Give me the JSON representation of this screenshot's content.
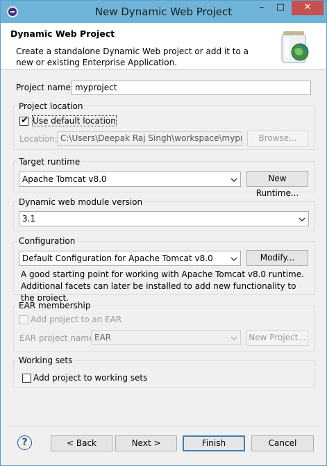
{
  "window": {
    "title": "New Dynamic Web Project",
    "minimize": "–",
    "maximize": "□",
    "close": "✕"
  },
  "banner": {
    "title": "Dynamic Web Project",
    "description": "Create a standalone Dynamic Web project or add it to a new or existing Enterprise Application.",
    "icon": "web-project-wizard-icon"
  },
  "project_name": {
    "label": "Project name:",
    "value": "myproject"
  },
  "project_location": {
    "group_title": "Project location",
    "use_default_label": "Use default location",
    "use_default_checked": true,
    "location_label": "Location:",
    "location_value": "C:\\Users\\Deepak Raj Singh\\workspace\\myproject",
    "browse_label": "Browse..."
  },
  "target_runtime": {
    "group_title": "Target runtime",
    "selected": "Apache Tomcat v8.0",
    "new_runtime_label": "New Runtime..."
  },
  "module_version": {
    "group_title": "Dynamic web module version",
    "selected": "3.1"
  },
  "configuration": {
    "group_title": "Configuration",
    "selected": "Default Configuration for Apache Tomcat v8.0",
    "modify_label": "Modify...",
    "description": "A good starting point for working with Apache Tomcat v8.0 runtime. Additional facets can later be installed to add new functionality to the project."
  },
  "ear_membership": {
    "group_title": "EAR membership",
    "add_label": "Add project to an EAR",
    "add_checked": false,
    "ear_name_label": "EAR project name:",
    "ear_name_value": "EAR",
    "new_project_label": "New Project..."
  },
  "working_sets": {
    "group_title": "Working sets",
    "add_label": "Add project to working sets",
    "add_checked": false
  },
  "footer": {
    "help": "?",
    "back_label": "< Back",
    "next_label": "Next >",
    "finish_label": "Finish",
    "cancel_label": "Cancel"
  }
}
